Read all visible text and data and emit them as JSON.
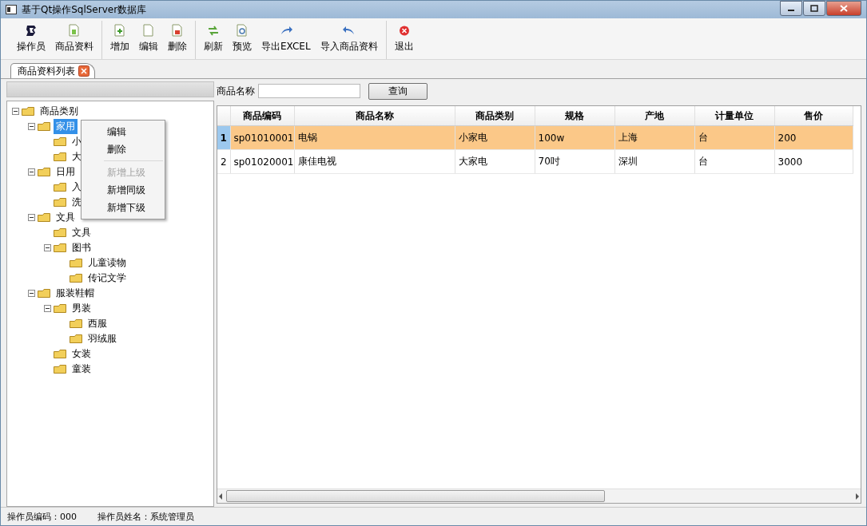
{
  "window": {
    "title": "基于Qt操作SqlServer数据库"
  },
  "toolbar": {
    "groups": [
      [
        {
          "label": "操作员"
        },
        {
          "label": "商品资料"
        }
      ],
      [
        {
          "label": "增加"
        },
        {
          "label": "编辑"
        },
        {
          "label": "删除"
        }
      ],
      [
        {
          "label": "刷新"
        },
        {
          "label": "预览"
        },
        {
          "label": "导出EXCEL"
        },
        {
          "label": "导入商品资料"
        }
      ],
      [
        {
          "label": "退出"
        }
      ]
    ]
  },
  "tabs": [
    {
      "label": "商品资料列表",
      "selected": true
    }
  ],
  "tree": {
    "nodes": [
      {
        "label": "商品类别",
        "expanded": true,
        "selected": false,
        "children": [
          {
            "label": "家用",
            "expanded": true,
            "selected": true,
            "children": [
              {
                "label": "小",
                "selected": false
              },
              {
                "label": "大",
                "selected": false
              }
            ]
          },
          {
            "label": "日用",
            "expanded": true,
            "selected": false,
            "children": [
              {
                "label": "入",
                "selected": false
              },
              {
                "label": "洗",
                "selected": false
              }
            ]
          },
          {
            "label": "文具",
            "expanded": true,
            "selected": false,
            "children": [
              {
                "label": "文具",
                "selected": false
              },
              {
                "label": "图书",
                "expanded": true,
                "selected": false,
                "children": [
                  {
                    "label": "儿童读物",
                    "selected": false
                  },
                  {
                    "label": "传记文学",
                    "selected": false
                  }
                ]
              }
            ]
          },
          {
            "label": "服装鞋帽",
            "expanded": true,
            "selected": false,
            "children": [
              {
                "label": "男装",
                "expanded": true,
                "selected": false,
                "children": [
                  {
                    "label": "西服",
                    "selected": false
                  },
                  {
                    "label": "羽绒服",
                    "selected": false
                  }
                ]
              },
              {
                "label": "女装",
                "selected": false
              },
              {
                "label": "童装",
                "selected": false
              }
            ]
          }
        ]
      }
    ]
  },
  "context_menu": {
    "items": [
      {
        "label": "编辑",
        "disabled": false,
        "separator_after": false
      },
      {
        "label": "删除",
        "disabled": false,
        "separator_after": true
      },
      {
        "label": "新增上级",
        "disabled": true,
        "separator_after": false
      },
      {
        "label": "新增同级",
        "disabled": false,
        "separator_after": false
      },
      {
        "label": "新增下级",
        "disabled": false,
        "separator_after": false
      }
    ]
  },
  "search": {
    "label": "商品名称",
    "button": "查询"
  },
  "table": {
    "columns": [
      "商品编码",
      "商品名称",
      "商品类别",
      "规格",
      "产地",
      "计量单位",
      "售价"
    ],
    "rows": [
      {
        "number": "1",
        "selected": true,
        "cells": [
          "sp01010001",
          "电锅",
          "小家电",
          "100w",
          "上海",
          "台",
          "200"
        ]
      },
      {
        "number": "2",
        "selected": false,
        "cells": [
          "sp01020001",
          "康佳电视",
          "大家电",
          "70吋",
          "深圳",
          "台",
          "3000"
        ]
      }
    ]
  },
  "status_bar": [
    "操作员编码：000",
    "操作员姓名：系统管理员"
  ]
}
